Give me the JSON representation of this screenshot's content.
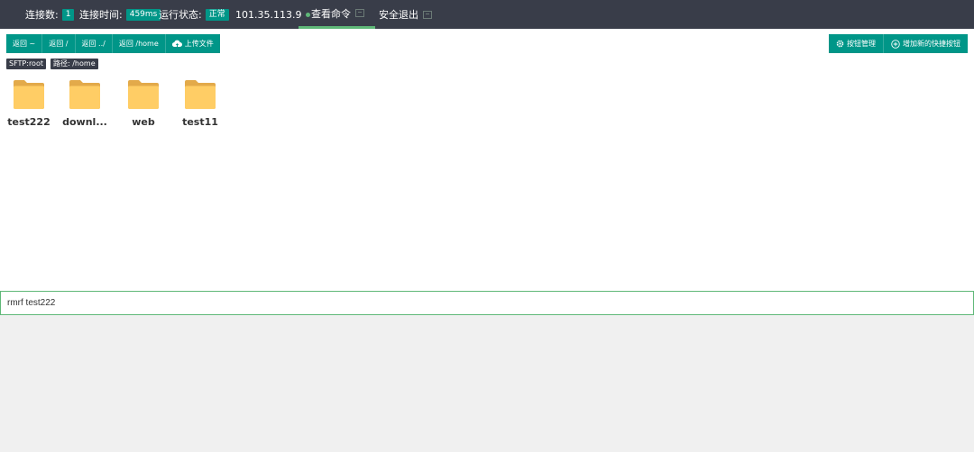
{
  "topbar": {
    "connections_label": "连接数:",
    "connections_value": "1",
    "time_label": "连接时间:",
    "time_value": "459ms",
    "status_label": "运行状态:",
    "status_value": "正常",
    "ip": "101.35.113.9",
    "tabs": [
      {
        "label": "查看命令",
        "active": true
      },
      {
        "label": "安全退出",
        "active": false
      }
    ]
  },
  "toolbar": {
    "nav_buttons": [
      "返回 ~",
      "返回 /",
      "返回 ../",
      "返回 /home"
    ],
    "upload_label": "上传文件",
    "manage_label": "按钮管理",
    "add_shortcut_label": "增加新的快捷按钮"
  },
  "tags": {
    "sftp": "SFTP:root",
    "path": "路径: /home"
  },
  "folders": [
    {
      "name": "test222"
    },
    {
      "name": "downl..."
    },
    {
      "name": "web"
    },
    {
      "name": "test11"
    }
  ],
  "command_input": {
    "value": "rmrf test222"
  },
  "colors": {
    "accent": "#009688",
    "topbar_bg": "#393d49",
    "active_tab": "#5fb878",
    "folder": "#ffcd65"
  }
}
